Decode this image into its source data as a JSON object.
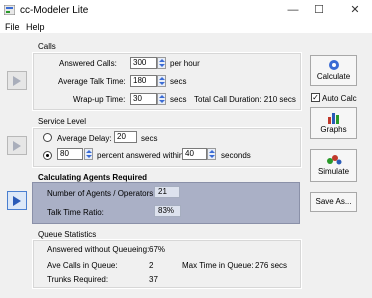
{
  "window": {
    "title": "cc-Modeler Lite",
    "minimize": "—",
    "maximize": "☐",
    "close": "✕"
  },
  "menu": [
    "File",
    "Help"
  ],
  "calls": {
    "title": "Calls",
    "answered_label": "Answered Calls:",
    "answered_value": "300",
    "answered_unit": "per hour",
    "talk_label": "Average Talk Time:",
    "talk_value": "180",
    "talk_unit": "secs",
    "wrap_label": "Wrap-up Time:",
    "wrap_value": "30",
    "wrap_unit": "secs",
    "total_label": "Total Call Duration: 210 secs"
  },
  "service": {
    "title": "Service Level",
    "avg_label": "Average Delay:",
    "avg_value": "20",
    "avg_unit": "secs",
    "pct_value": "80",
    "pct_label": "percent answered within",
    "within_value": "40",
    "within_unit": "seconds"
  },
  "agents": {
    "title": "Calculating Agents Required",
    "num_label": "Number of Agents / Operators:",
    "num_value": "21",
    "ratio_label": "Talk Time Ratio:",
    "ratio_value": "83%"
  },
  "queue": {
    "title": "Queue Statistics",
    "answered_label": "Answered without Queueing:",
    "answered_value": "67%",
    "ave_label": "Ave Calls in Queue:",
    "ave_value": "2",
    "max_label": "Max Time in Queue:",
    "max_value": "276 secs",
    "trunks_label": "Trunks Required:",
    "trunks_value": "37"
  },
  "buttons": {
    "calculate": "Calculate",
    "autocalc": "Auto Calc",
    "graphs": "Graphs",
    "simulate": "Simulate",
    "saveas": "Save As..."
  },
  "colors": {
    "agents_bg": "#aab0c6"
  }
}
